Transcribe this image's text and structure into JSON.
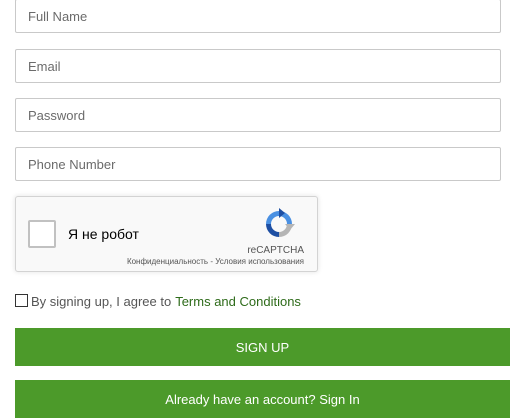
{
  "form": {
    "full_name": {
      "placeholder": "Full Name",
      "value": ""
    },
    "email": {
      "placeholder": "Email",
      "value": ""
    },
    "password": {
      "placeholder": "Password",
      "value": ""
    },
    "phone": {
      "placeholder": "Phone Number",
      "value": ""
    }
  },
  "recaptcha": {
    "label": "Я не робот",
    "brand": "reCAPTCHA",
    "privacy": "Конфиденциальность",
    "separator": " - ",
    "terms": "Условия использования",
    "checked": false
  },
  "agreement": {
    "checked": false,
    "text": "By signing up, I agree to",
    "link": "Terms and Conditions"
  },
  "buttons": {
    "signup": "SIGN UP",
    "signin": "Already have an account? Sign In"
  },
  "colors": {
    "accent": "#4c9a2a",
    "link": "#2e6b1a",
    "border": "#c9c9c9"
  },
  "icons": {
    "recaptcha_logo": "recaptcha-logo-icon",
    "checkbox": "checkbox-icon"
  }
}
